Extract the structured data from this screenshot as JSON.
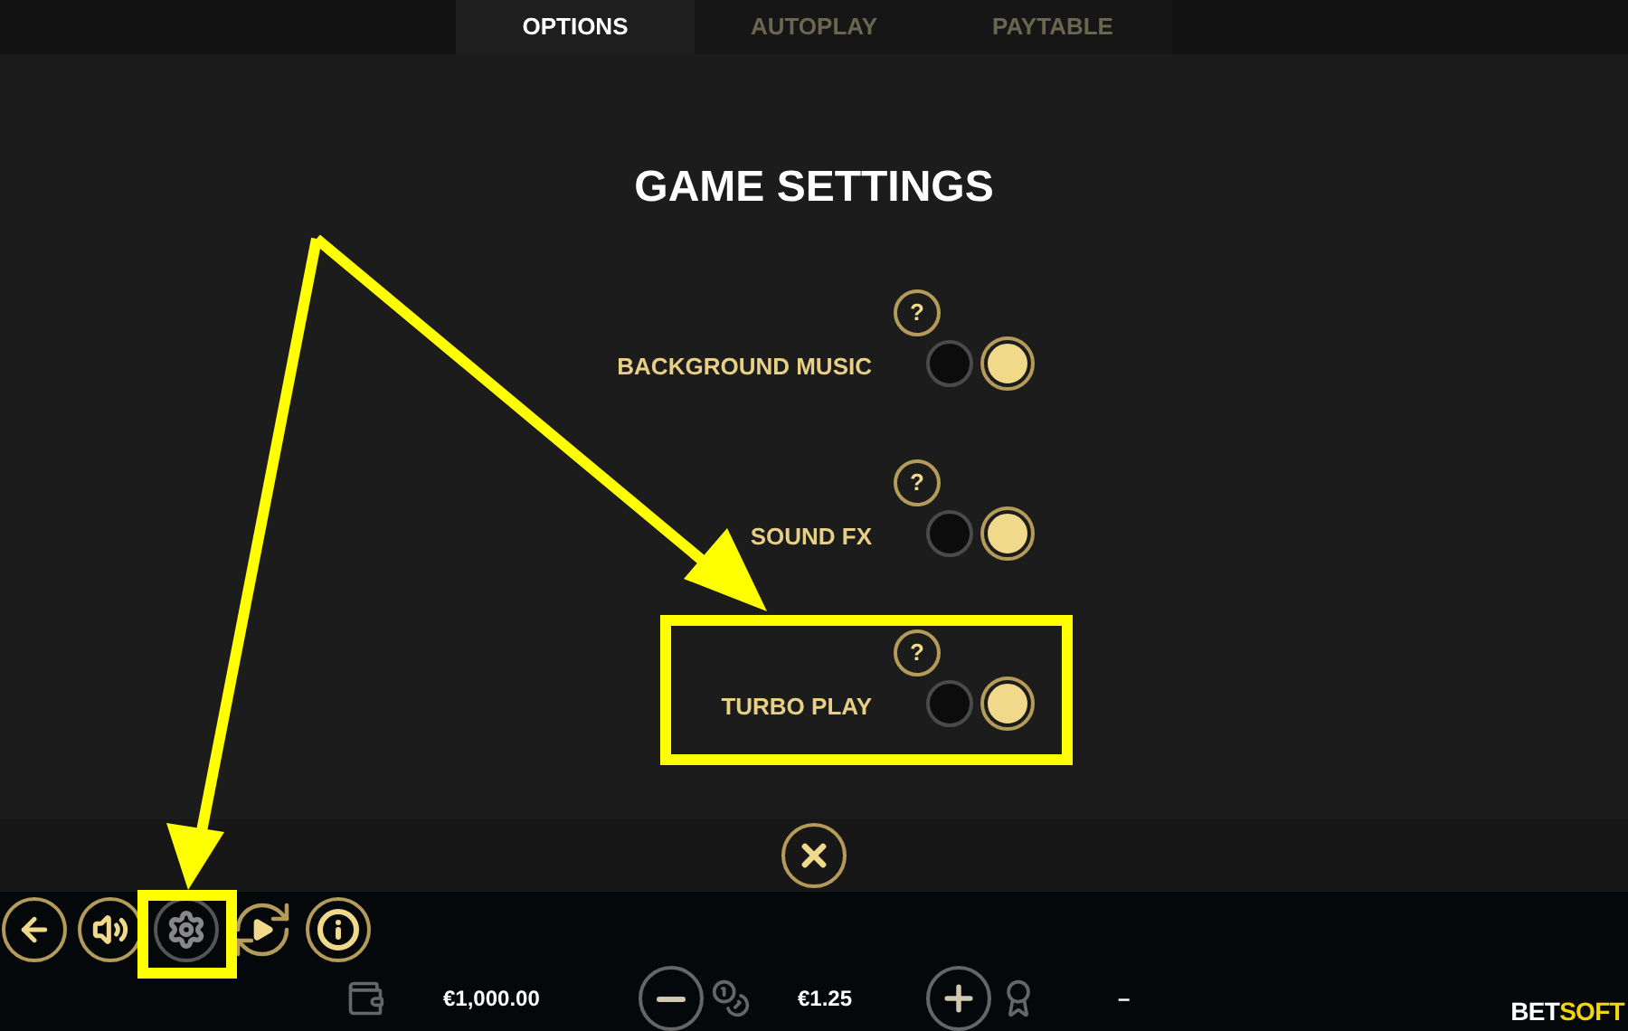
{
  "tabs": [
    {
      "label": "OPTIONS",
      "selected": true
    },
    {
      "label": "AUTOPLAY",
      "selected": false
    },
    {
      "label": "PAYTABLE",
      "selected": false
    }
  ],
  "title": "GAME SETTINGS",
  "settings": [
    {
      "label": "BACKGROUND MUSIC",
      "help": "?",
      "on": true
    },
    {
      "label": "SOUND FX",
      "help": "?",
      "on": true
    },
    {
      "label": "TURBO PLAY",
      "help": "?",
      "on": true
    }
  ],
  "toolbar": {
    "balance": "€1,000.00",
    "bet": "€1.25",
    "win": "–"
  },
  "logo": {
    "part_1": "BET",
    "part_2": "SOFT"
  }
}
